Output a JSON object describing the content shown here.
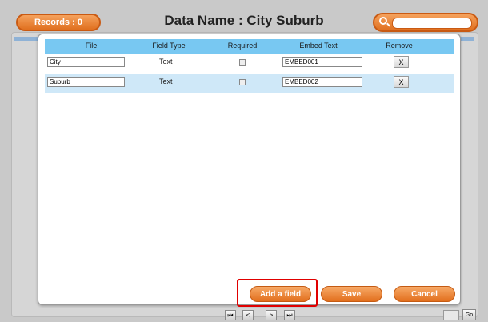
{
  "header": {
    "records_label": "Records : 0",
    "title": "Data Name : City Suburb",
    "search_value": ""
  },
  "modal": {
    "columns": [
      "File",
      "Field Type",
      "Required",
      "Embed Text",
      "Remove"
    ],
    "rows": [
      {
        "file": "City",
        "field_type": "Text",
        "required": false,
        "embed_text": "EMBED001",
        "remove_label": "X"
      },
      {
        "file": "Suburb",
        "field_type": "Text",
        "required": false,
        "embed_text": "EMBED002",
        "remove_label": "X"
      }
    ],
    "buttons": {
      "add_field": "Add a field",
      "save": "Save",
      "cancel": "Cancel"
    }
  },
  "pager": {
    "first": "⏮",
    "prev": "<",
    "next": ">",
    "last": "⏭",
    "go": "Go"
  },
  "colors": {
    "accent_orange": "#e2701f",
    "table_header": "#78c8f2",
    "highlight": "#e00000"
  }
}
